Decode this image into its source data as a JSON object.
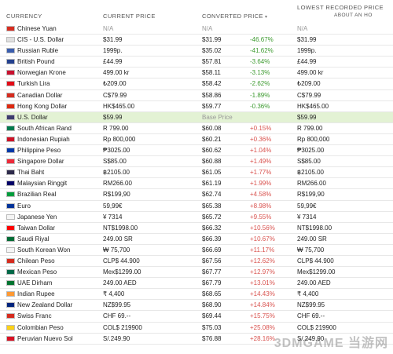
{
  "header": {
    "currency": "CURRENCY",
    "current_price": "CURRENT PRICE",
    "converted_price": "CONVERTED PRICE",
    "lowest_recorded": "LOWEST RECORDED PRICE",
    "about": "ABOUT AN HO"
  },
  "rows": [
    {
      "name": "Chinese Yuan",
      "current": "N/A",
      "converted": "N/A",
      "pct": "",
      "lowest": "N/A",
      "flag": "#d62d20",
      "na": true
    },
    {
      "name": "CIS - U.S. Dollar",
      "current": "$31.99",
      "converted": "$31.99",
      "pct": "-46.67%",
      "lowest": "$31.99",
      "flag": "#e0e0e0"
    },
    {
      "name": "Russian Ruble",
      "current": "1999p.",
      "converted": "$35.02",
      "pct": "-41.62%",
      "lowest": "1999p.",
      "flag": "#3a5dae"
    },
    {
      "name": "British Pound",
      "current": "£44.99",
      "converted": "$57.81",
      "pct": "-3.64%",
      "lowest": "£44.99",
      "flag": "#23408e"
    },
    {
      "name": "Norwegian Krone",
      "current": "499.00 kr",
      "converted": "$58.11",
      "pct": "-3.13%",
      "lowest": "499.00 kr",
      "flag": "#c8102e"
    },
    {
      "name": "Turkish Lira",
      "current": "₺209.00",
      "converted": "$58.42",
      "pct": "-2.62%",
      "lowest": "₺209.00",
      "flag": "#e30a17"
    },
    {
      "name": "Canadian Dollar",
      "current": "C$79.99",
      "converted": "$58.86",
      "pct": "-1.89%",
      "lowest": "C$79.99",
      "flag": "#d52b1e"
    },
    {
      "name": "Hong Kong Dollar",
      "current": "HK$465.00",
      "converted": "$59.77",
      "pct": "-0.36%",
      "lowest": "HK$465.00",
      "flag": "#de2910"
    },
    {
      "name": "U.S. Dollar",
      "current": "$59.99",
      "converted": "Base Price",
      "pct": "",
      "lowest": "$59.99",
      "flag": "#3c3b6e",
      "base": true
    },
    {
      "name": "South African Rand",
      "current": "R 799.00",
      "converted": "$60.08",
      "pct": "+0.15%",
      "lowest": "R 799.00",
      "flag": "#007a4d"
    },
    {
      "name": "Indonesian Rupiah",
      "current": "Rp 800,000",
      "converted": "$60.21",
      "pct": "+0.36%",
      "lowest": "Rp 800,000",
      "flag": "#ce1126"
    },
    {
      "name": "Philippine Peso",
      "current": "₱3025.00",
      "converted": "$60.62",
      "pct": "+1.04%",
      "lowest": "₱3025.00",
      "flag": "#0038a8"
    },
    {
      "name": "Singapore Dollar",
      "current": "S$85.00",
      "converted": "$60.88",
      "pct": "+1.49%",
      "lowest": "S$85.00",
      "flag": "#ed2939"
    },
    {
      "name": "Thai Baht",
      "current": "฿2105.00",
      "converted": "$61.05",
      "pct": "+1.77%",
      "lowest": "฿2105.00",
      "flag": "#2d2a4a"
    },
    {
      "name": "Malaysian Ringgit",
      "current": "RM266.00",
      "converted": "$61.19",
      "pct": "+1.99%",
      "lowest": "RM266.00",
      "flag": "#010066"
    },
    {
      "name": "Brazilian Real",
      "current": "R$199,90",
      "converted": "$62.74",
      "pct": "+4.58%",
      "lowest": "R$199,90",
      "flag": "#009c3b"
    },
    {
      "name": "Euro",
      "current": "59,99€",
      "converted": "$65.38",
      "pct": "+8.98%",
      "lowest": "59,99€",
      "flag": "#003399"
    },
    {
      "name": "Japanese Yen",
      "current": "¥ 7314",
      "converted": "$65.72",
      "pct": "+9.55%",
      "lowest": "¥ 7314",
      "flag": "#f5f5f5"
    },
    {
      "name": "Taiwan Dollar",
      "current": "NT$1998.00",
      "converted": "$66.32",
      "pct": "+10.56%",
      "lowest": "NT$1998.00",
      "flag": "#fe0000"
    },
    {
      "name": "Saudi Riyal",
      "current": "249.00 SR",
      "converted": "$66.39",
      "pct": "+10.67%",
      "lowest": "249.00 SR",
      "flag": "#006c35"
    },
    {
      "name": "South Korean Won",
      "current": "₩ 75,700",
      "converted": "$66.69",
      "pct": "+11.17%",
      "lowest": "₩ 75,700",
      "flag": "#f5f5f5"
    },
    {
      "name": "Chilean Peso",
      "current": "CLP$ 44.900",
      "converted": "$67.56",
      "pct": "+12.62%",
      "lowest": "CLP$ 44.900",
      "flag": "#d52b1e"
    },
    {
      "name": "Mexican Peso",
      "current": "Mex$1299.00",
      "converted": "$67.77",
      "pct": "+12.97%",
      "lowest": "Mex$1299.00",
      "flag": "#006847"
    },
    {
      "name": "UAE Dirham",
      "current": "249.00 AED",
      "converted": "$67.79",
      "pct": "+13.01%",
      "lowest": "249.00 AED",
      "flag": "#00732f"
    },
    {
      "name": "Indian Rupee",
      "current": "₹ 4,400",
      "converted": "$68.65",
      "pct": "+14.43%",
      "lowest": "₹ 4,400",
      "flag": "#ff9933"
    },
    {
      "name": "New Zealand Dollar",
      "current": "NZ$99.95",
      "converted": "$68.90",
      "pct": "+14.84%",
      "lowest": "NZ$99.95",
      "flag": "#00247d"
    },
    {
      "name": "Swiss Franc",
      "current": "CHF 69.--",
      "converted": "$69.44",
      "pct": "+15.75%",
      "lowest": "CHF 69.--",
      "flag": "#d52b1e"
    },
    {
      "name": "Colombian Peso",
      "current": "COL$ 219900",
      "converted": "$75.03",
      "pct": "+25.08%",
      "lowest": "COL$ 219900",
      "flag": "#fcd116"
    },
    {
      "name": "Peruvian Nuevo Sol",
      "current": "S/.249.90",
      "converted": "$76.88",
      "pct": "+28.16%",
      "lowest": "S/.249.90",
      "flag": "#d91023"
    }
  ],
  "watermark": "3DMGAME 当游网"
}
